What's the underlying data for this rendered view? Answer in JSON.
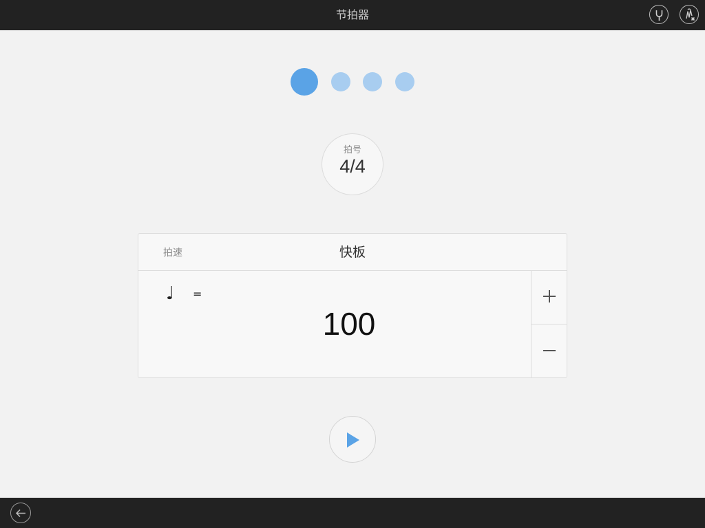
{
  "header": {
    "title": "节拍器",
    "icons": [
      "tuning-fork-icon",
      "vibration-off-icon"
    ]
  },
  "beats": {
    "count": 4,
    "active_index": 0,
    "colors": {
      "active": "#5aa3e6",
      "inactive": "#a8cdf0"
    }
  },
  "time_signature": {
    "label": "拍号",
    "value": "4/4"
  },
  "tempo": {
    "label": "拍速",
    "marking": "快板",
    "note_symbol": "♩",
    "equals": "=",
    "bpm": "100",
    "increase_icon": "plus-icon",
    "decrease_icon": "minus-icon"
  },
  "controls": {
    "play_icon": "play-icon",
    "play_color": "#5aa3e6"
  },
  "footer": {
    "back_icon": "back-arrow-icon"
  }
}
